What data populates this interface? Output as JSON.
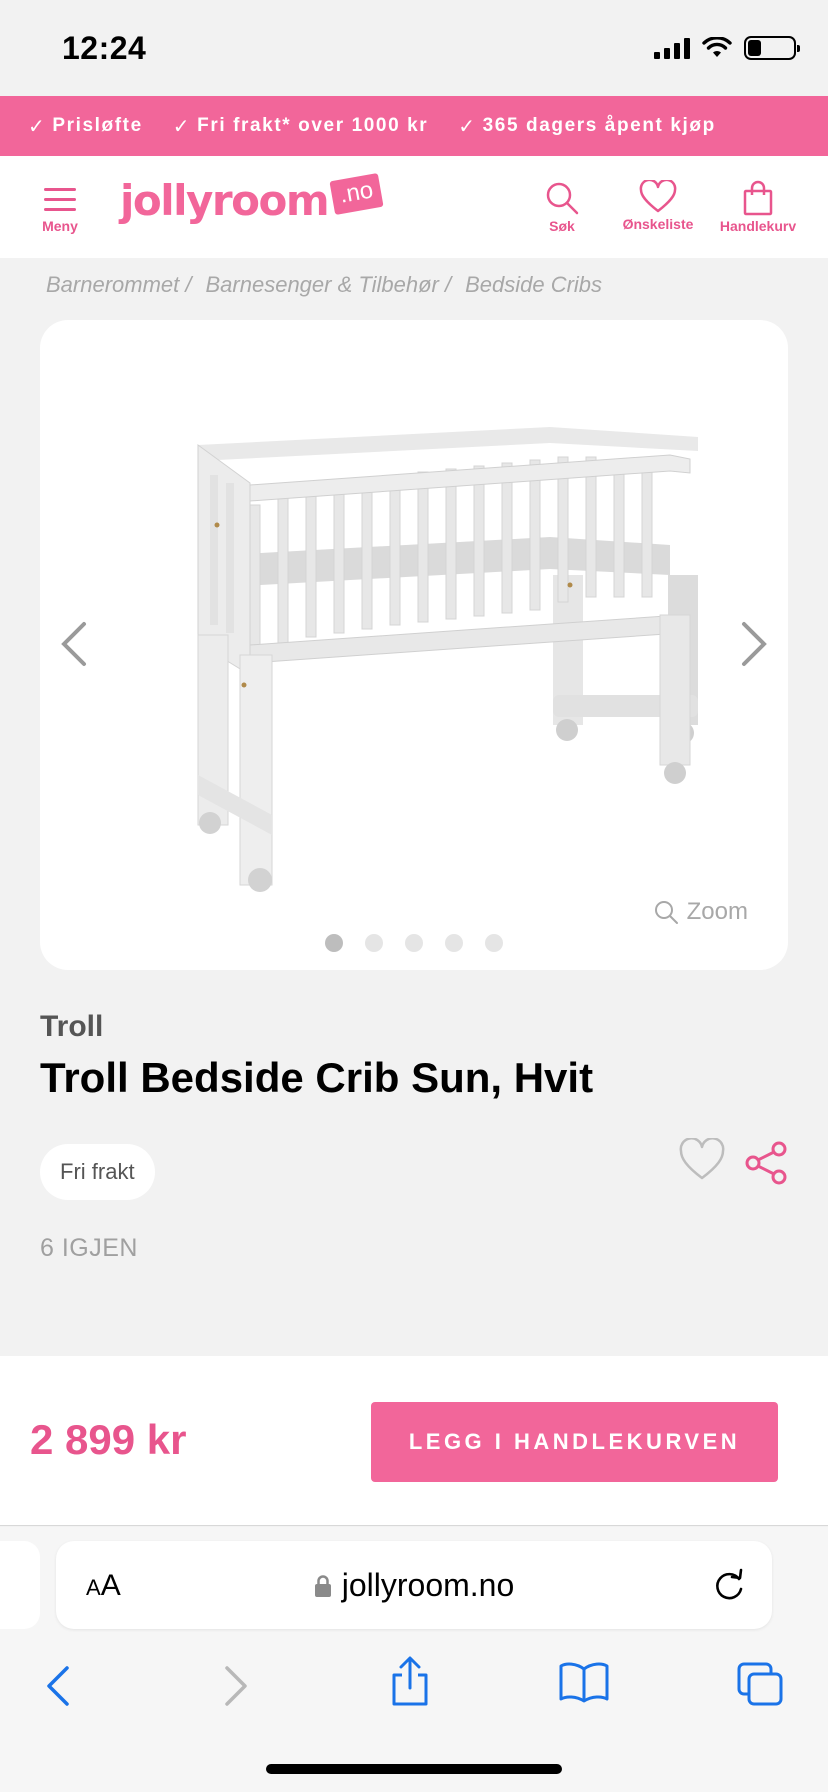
{
  "status_bar": {
    "time": "12:24",
    "battery_level": 0.3
  },
  "promo": [
    {
      "icon": "check-icon",
      "text": "Prisløfte"
    },
    {
      "icon": "check-icon",
      "text": "Fri frakt* over 1000 kr"
    },
    {
      "icon": "check-icon",
      "text": "365 dagers åpent kjøp"
    }
  ],
  "header": {
    "menu_label": "Meny",
    "logo_text": "jollyroom",
    "logo_badge": ".no",
    "search_label": "Søk",
    "wishlist_label": "Ønskeliste",
    "cart_label": "Handlekurv"
  },
  "breadcrumb": [
    "Barnerommet /",
    "Barnesenger & Tilbehør /",
    "Bedside Cribs"
  ],
  "gallery": {
    "zoom_label": "Zoom",
    "image_count": 5,
    "active_index": 0
  },
  "product": {
    "brand": "Troll",
    "title": "Troll Bedside Crib Sun, Hvit",
    "badge": "Fri frakt",
    "stock": "6 IGJEN"
  },
  "buy_bar": {
    "price": "2 899 kr",
    "cta_label": "LEGG I HANDLEKURVEN"
  },
  "browser": {
    "text_size_label": "AA",
    "url": "jollyroom.no"
  },
  "colors": {
    "brand_pink": "#f2669a",
    "accent_pink": "#e8558d"
  }
}
